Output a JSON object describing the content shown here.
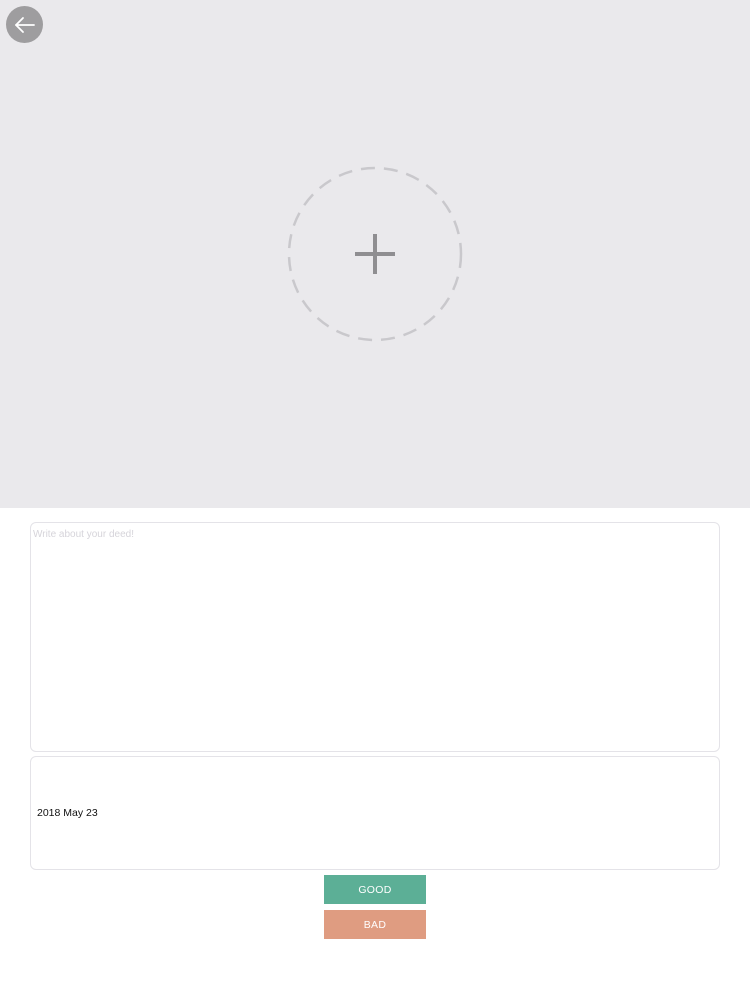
{
  "photo_picker": {
    "background_color": "#eae9ec",
    "back_icon": "arrow-left-icon",
    "add_icon": "plus-icon"
  },
  "deed_input": {
    "value": "",
    "placeholder": "Write about your deed!"
  },
  "date_field": {
    "value": "2018 May 23"
  },
  "buttons": {
    "good_label": "GOOD",
    "good_color": "#5caf96",
    "bad_label": "BAD",
    "bad_color": "#df9c81"
  }
}
